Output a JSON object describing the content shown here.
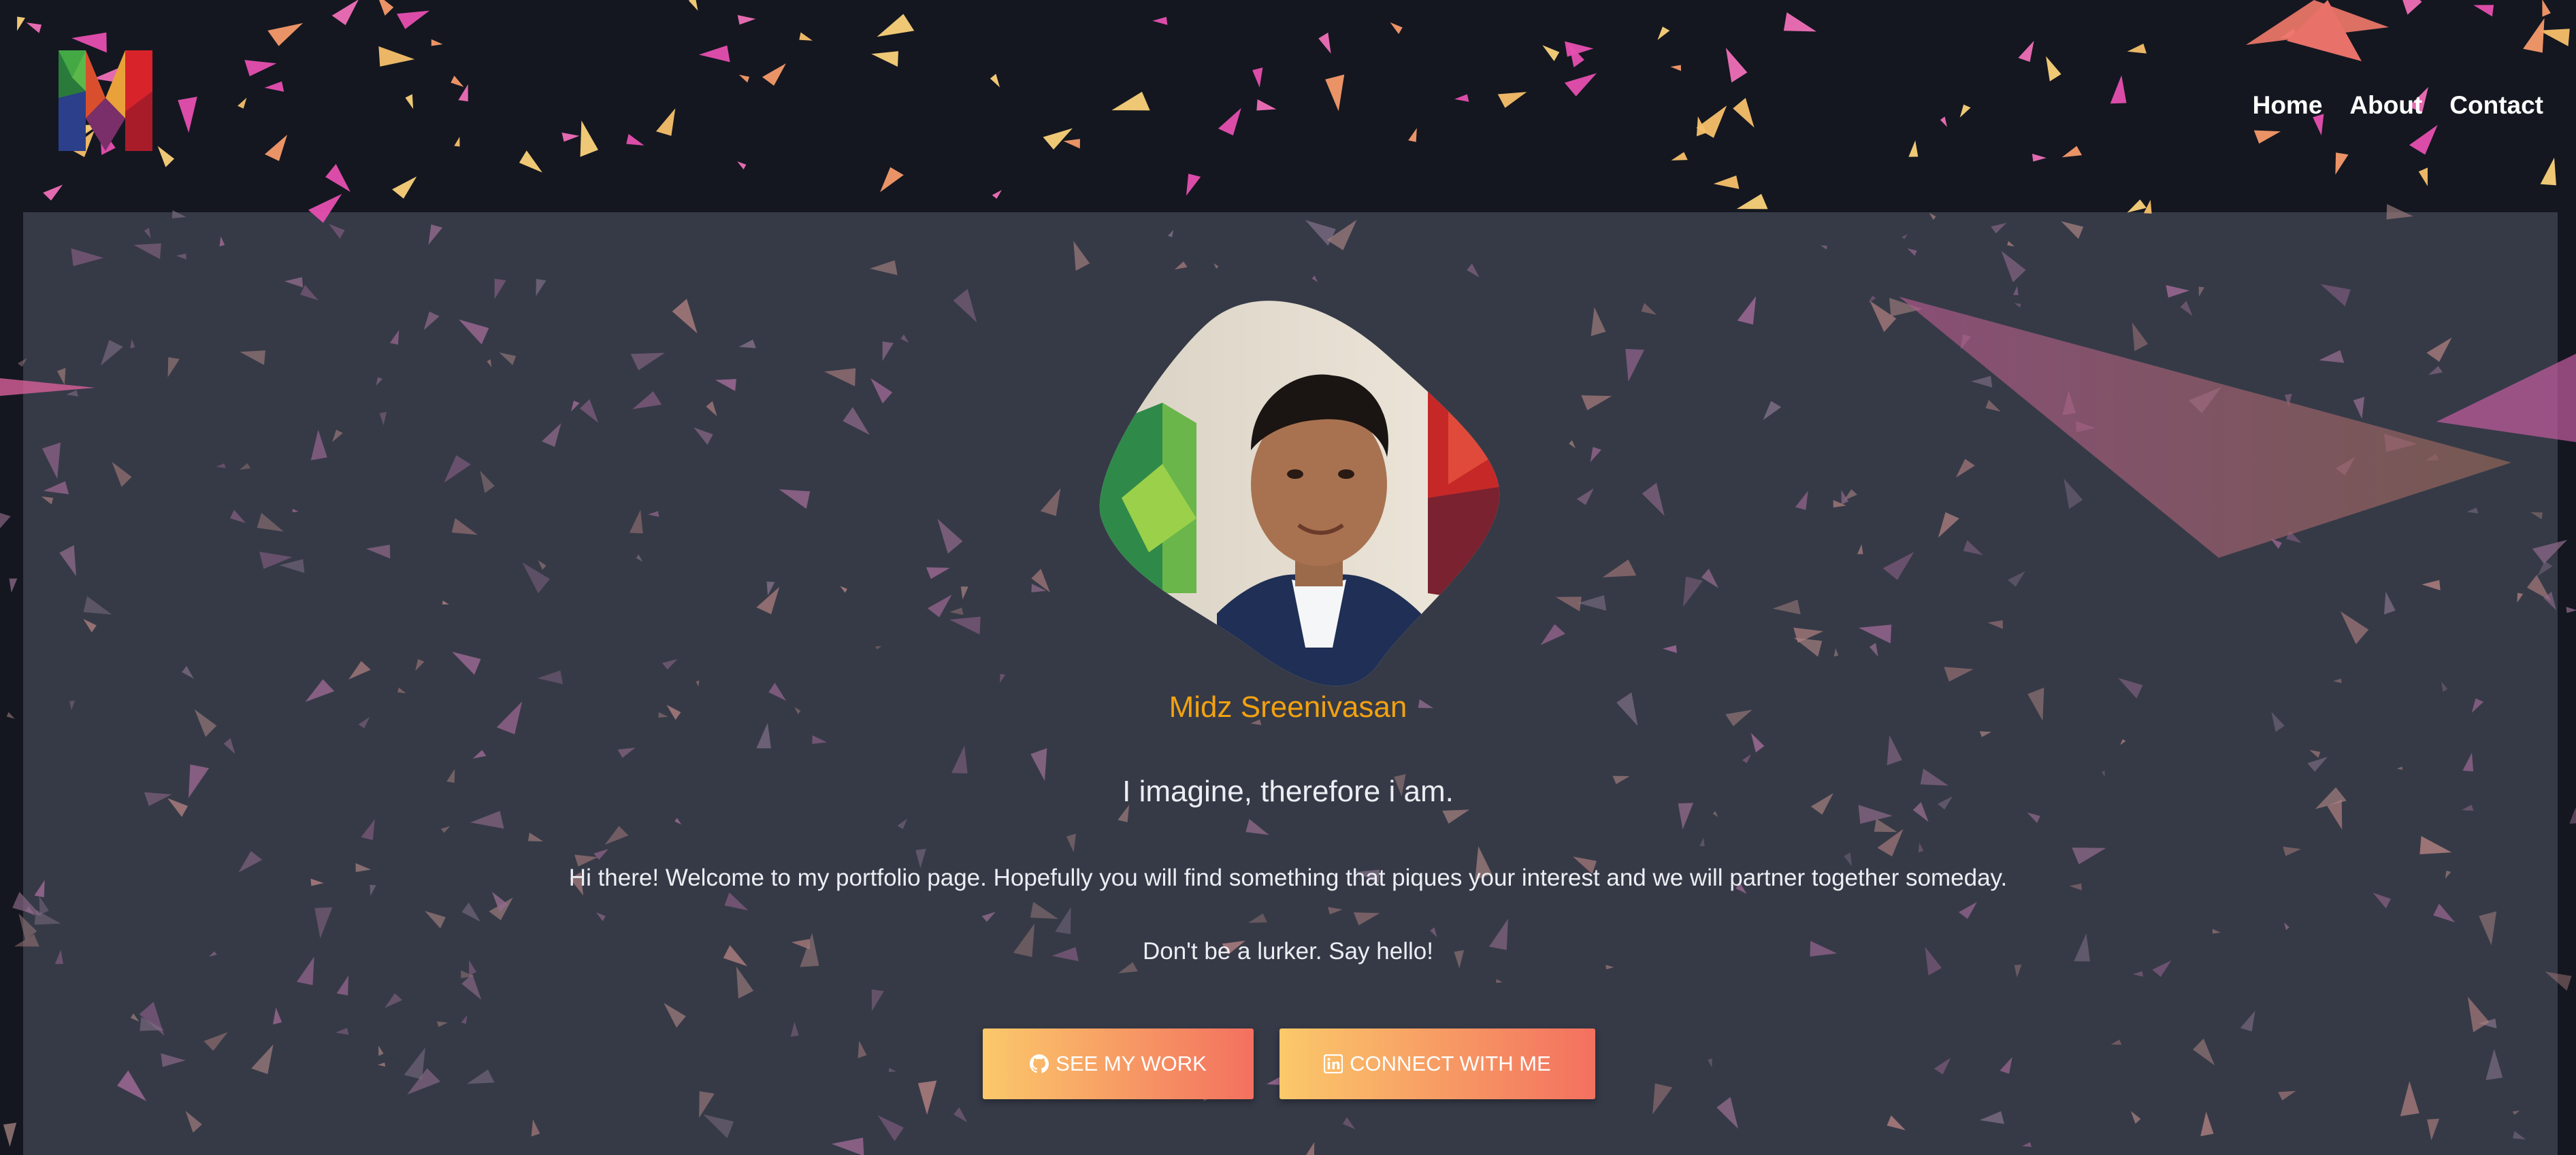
{
  "header": {
    "logo_icon": "m-logo-icon",
    "nav": [
      {
        "label": "Home"
      },
      {
        "label": "About"
      },
      {
        "label": "Contact"
      }
    ]
  },
  "profile": {
    "name": "Midz Sreenivasan",
    "tagline": "I imagine, therefore i am.",
    "intro": "Hi there! Welcome to my portfolio page. Hopefully you will find something that piques your interest and we will partner together someday.",
    "cta_text": "Don't be a lurker. Say hello!"
  },
  "buttons": {
    "work": {
      "label": "SEE MY WORK",
      "icon": "github-icon"
    },
    "connect": {
      "label": "CONNECT WITH ME",
      "icon": "linkedin-icon"
    }
  },
  "colors": {
    "page_background": "#141720",
    "panel_background": "#363a47",
    "name_accent": "#f2a20f",
    "button_gradient_start": "#fbc96a",
    "button_gradient_end": "#f3705f",
    "text": "#eceef3"
  }
}
